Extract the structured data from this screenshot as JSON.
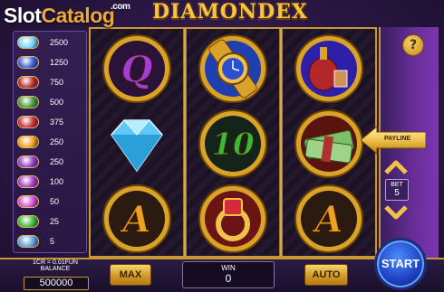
{
  "watermark": {
    "brand_a": "Slot",
    "brand_b": "Catalog",
    "tld": ".com"
  },
  "title": "DIAMONDEX",
  "help": {
    "label": "?"
  },
  "paytable": [
    {
      "symbol": "diamond",
      "value": "2500",
      "color": "#6fd3ff"
    },
    {
      "symbol": "watch",
      "value": "1250",
      "color": "#2e5bd6"
    },
    {
      "symbol": "cognac",
      "value": "750",
      "color": "#b3262a"
    },
    {
      "symbol": "money",
      "value": "500",
      "color": "#3a9a3a"
    },
    {
      "symbol": "ring",
      "value": "375",
      "color": "#c82a3a"
    },
    {
      "symbol": "ace",
      "value": "250",
      "color": "#f0a020"
    },
    {
      "symbol": "king",
      "value": "250",
      "color": "#8a3ac8"
    },
    {
      "symbol": "queen",
      "value": "100",
      "color": "#a03ad0"
    },
    {
      "symbol": "jack",
      "value": "50",
      "color": "#d04ad0"
    },
    {
      "symbol": "ten",
      "value": "25",
      "color": "#3ab83a"
    },
    {
      "symbol": "nine",
      "value": "5",
      "color": "#58a0e0"
    }
  ],
  "reels": [
    [
      {
        "symbol": "queen",
        "label": "Q"
      },
      {
        "symbol": "diamond",
        "label": ""
      },
      {
        "symbol": "ace",
        "label": "A"
      }
    ],
    [
      {
        "symbol": "watch",
        "label": ""
      },
      {
        "symbol": "ten",
        "label": "10"
      },
      {
        "symbol": "ring",
        "label": ""
      }
    ],
    [
      {
        "symbol": "cognac",
        "label": ""
      },
      {
        "symbol": "money",
        "label": ""
      },
      {
        "symbol": "ace",
        "label": "A"
      }
    ]
  ],
  "payline": {
    "label": "PAYLINE"
  },
  "bet": {
    "label": "BET",
    "value": "5"
  },
  "coin": {
    "rate": "1CR = 0.01FUN"
  },
  "balance": {
    "label": "BALANCE",
    "value": "500000"
  },
  "win": {
    "label": "WIN",
    "value": "0"
  },
  "buttons": {
    "max": "MAX",
    "auto": "AUTO",
    "start": "START"
  }
}
